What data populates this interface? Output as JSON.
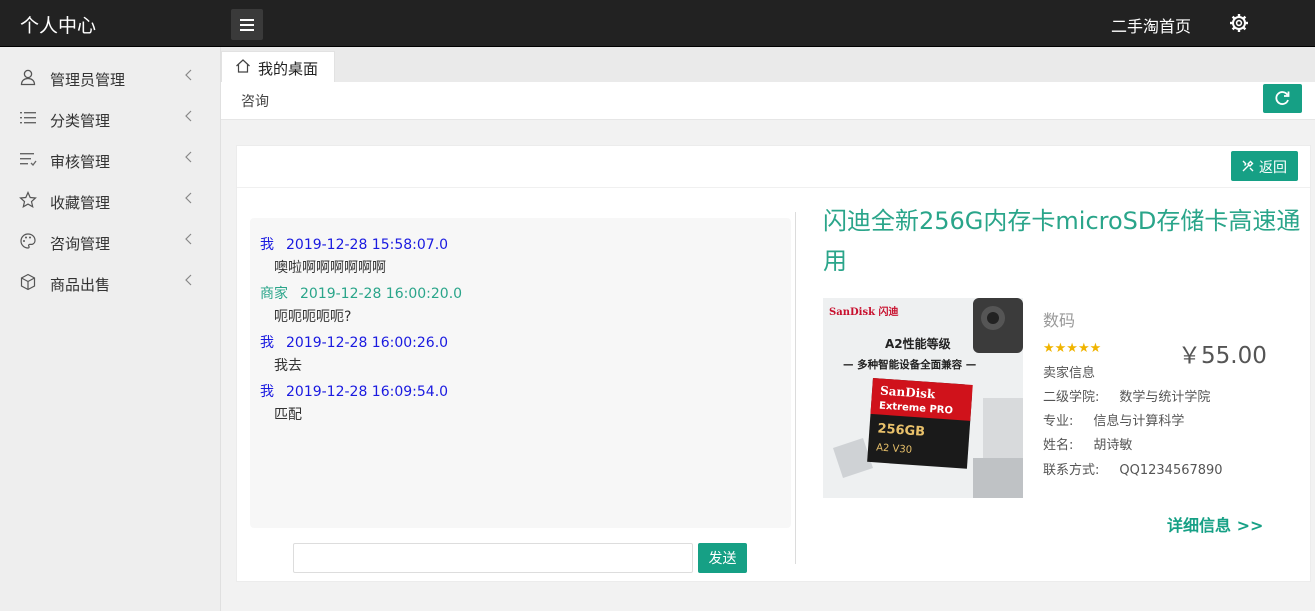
{
  "app": {
    "title": "个人中心"
  },
  "topbar": {
    "home_label": "二手淘首页"
  },
  "sidebar": {
    "items": [
      {
        "label": "管理员管理",
        "icon": "user-icon"
      },
      {
        "label": "分类管理",
        "icon": "list-icon"
      },
      {
        "label": "审核管理",
        "icon": "list-check-icon"
      },
      {
        "label": "收藏管理",
        "icon": "star-icon"
      },
      {
        "label": "咨询管理",
        "icon": "palette-icon"
      },
      {
        "label": "商品出售",
        "icon": "cube-icon"
      }
    ]
  },
  "tabs": {
    "active_label": "我的桌面"
  },
  "breadcrumb": {
    "current": "咨询"
  },
  "card": {
    "back_label": "返回"
  },
  "chat": {
    "messages": [
      {
        "who": "我",
        "time": "2019-12-28 15:58:07.0",
        "text": "噢啦啊啊啊啊啊啊"
      },
      {
        "who": "商家",
        "time": "2019-12-28 16:00:20.0",
        "text": "呃呃呃呃呃?"
      },
      {
        "who": "我",
        "time": "2019-12-28 16:00:26.0",
        "text": "我去"
      },
      {
        "who": "我",
        "time": "2019-12-28 16:09:54.0",
        "text": "匹配"
      }
    ],
    "input_value": "",
    "send_label": "发送"
  },
  "product": {
    "title": "闪迪全新256G内存卡microSD存储卡高速通用",
    "category": "数码",
    "rating_stars": "★★★★★",
    "price": "￥55.00",
    "seller_info_title": "卖家信息",
    "info": [
      {
        "key": "二级学院:",
        "value": "数学与统计学院"
      },
      {
        "key": "专业:",
        "value": "信息与计算科学"
      },
      {
        "key": "姓名:",
        "value": "胡诗敏"
      },
      {
        "key": "联系方式:",
        "value": "QQ1234567890"
      }
    ],
    "detail_link": "详细信息 >>",
    "image": {
      "brand": "SanDisk 闪迪",
      "headline1": "A2性能等级",
      "headline2": "— 多种智能设备全面兼容 —",
      "card_brand": "SanDisk",
      "card_line": "Extreme PRO",
      "card_capacity": "256GB",
      "card_marks": "A2 V30"
    }
  },
  "colors": {
    "accent": "#16a085",
    "topbar": "#222222",
    "me": "#1a1ae0",
    "seller": "#2aa58a"
  }
}
